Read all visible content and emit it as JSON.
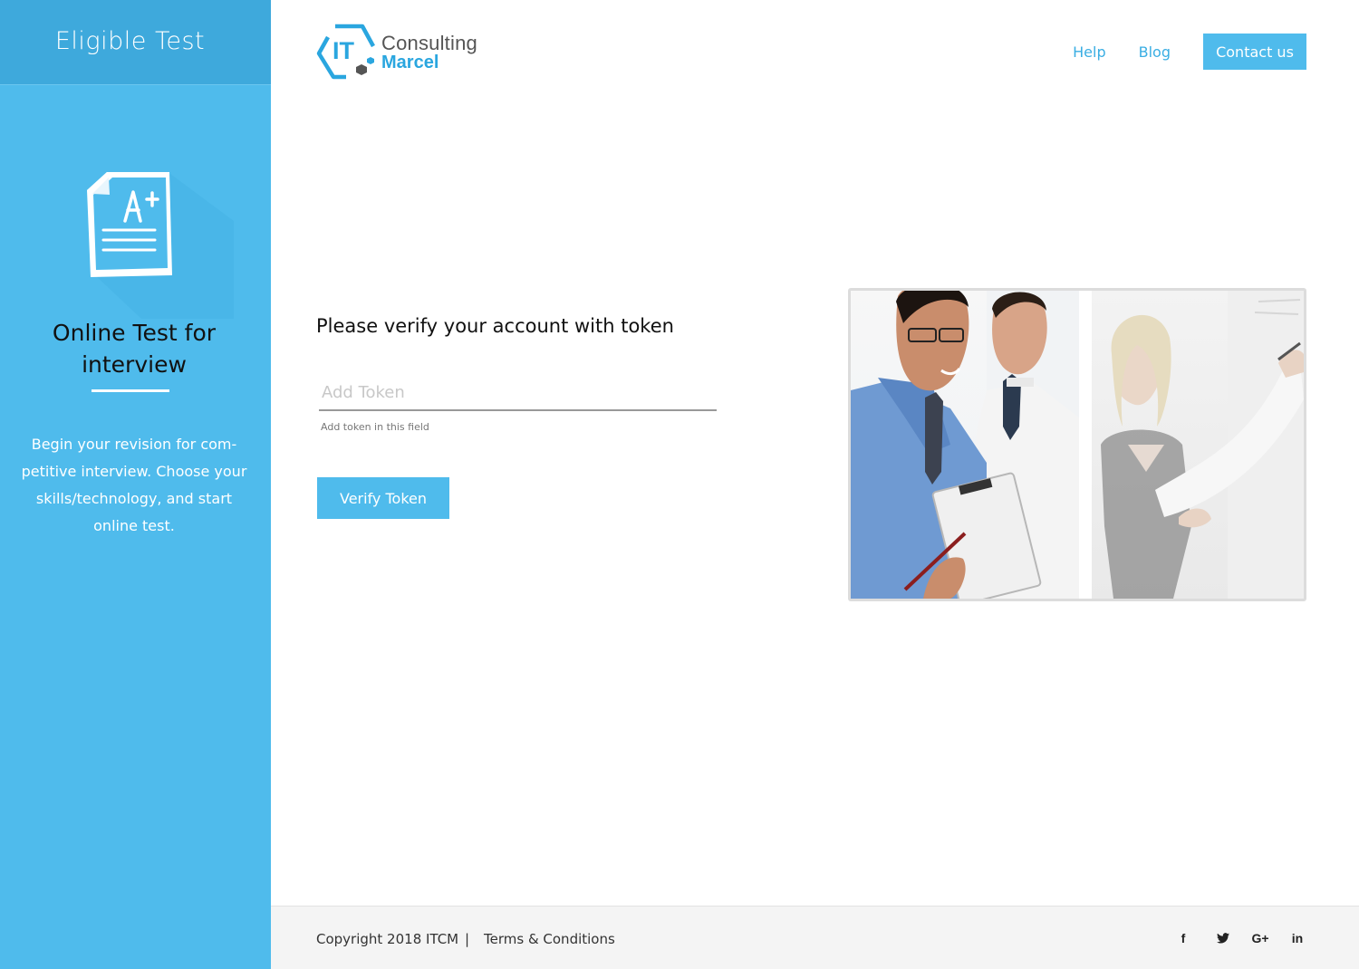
{
  "sidebar": {
    "title": "Eligible Test",
    "subtitle": "Online Test for interview",
    "description": "Begin your revision for com-petitive interview. Choose your skills/technology, and start online test."
  },
  "logo": {
    "badge": "IT",
    "line1": "Consulting",
    "line2": "Marcel"
  },
  "nav": {
    "help": "Help",
    "blog": "Blog",
    "contact": "Contact us"
  },
  "form": {
    "heading": "Please verify your account with token",
    "token_placeholder": "Add Token",
    "token_value": "",
    "token_help": "Add token in this field",
    "submit_label": "Verify Token"
  },
  "footer": {
    "copyright": "Copyright 2018 ITCM",
    "separator": "|",
    "terms": "Terms & Conditions",
    "social": {
      "facebook": "f",
      "twitter": "t",
      "google_plus": "G+",
      "linkedin": "in"
    }
  },
  "colors": {
    "primary": "#4fbbec",
    "primary_dark": "#3ea9dc",
    "logo_blue": "#2aa6df",
    "footer_bg": "#f4f4f4"
  }
}
